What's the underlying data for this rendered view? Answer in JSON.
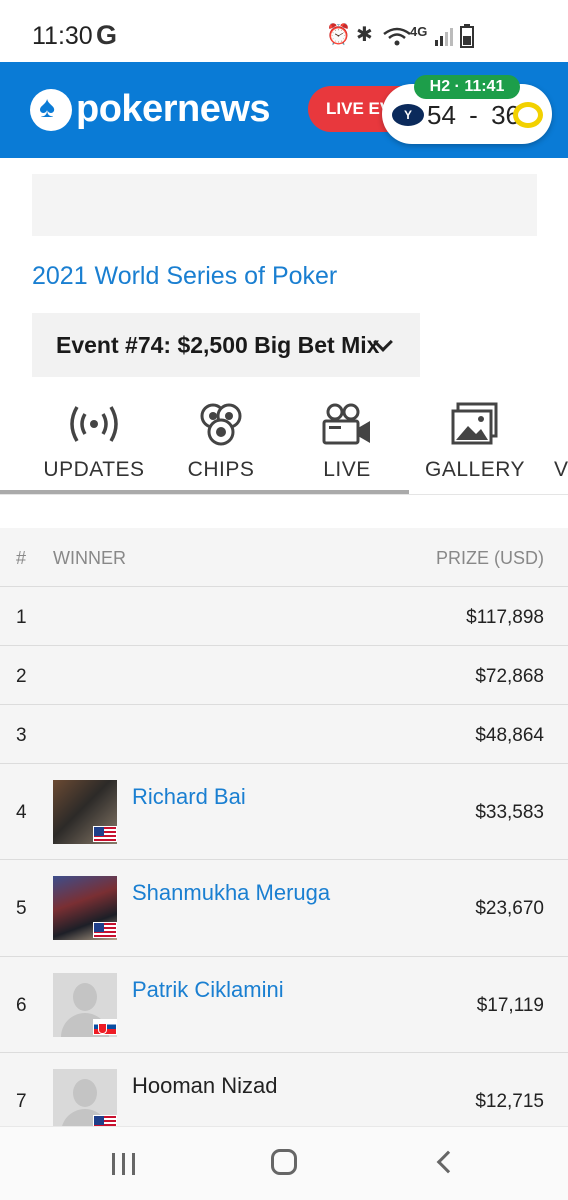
{
  "status_bar": {
    "time": "11:30",
    "g_icon": "G",
    "icons": [
      "alarm-icon",
      "bluetooth-icon",
      "wifi-icon",
      "lte-icon",
      "signal-icon",
      "battery-icon"
    ],
    "network": "4G"
  },
  "header": {
    "logo_text": "pokernews",
    "live_events_label": "LIVE EVE",
    "score": {
      "period": "H2 · 11:41",
      "team1_score": "54",
      "separator": "-",
      "team2_score": "36",
      "team1_icon": "byu-team-logo",
      "team2_icon": "oregon-team-logo"
    }
  },
  "breadcrumb": {
    "series_link": "2021 World Series of Poker"
  },
  "event_select": {
    "selected": "Event #74: $2,500 Big Bet Mix"
  },
  "tabs": [
    {
      "label": "UPDATES",
      "icon": "broadcast-icon"
    },
    {
      "label": "CHIPS",
      "icon": "chips-icon"
    },
    {
      "label": "LIVE",
      "icon": "video-camera-icon"
    },
    {
      "label": "GALLERY",
      "icon": "gallery-icon"
    },
    {
      "label": "V",
      "icon": ""
    }
  ],
  "table": {
    "headers": {
      "rank": "#",
      "winner": "WINNER",
      "prize": "PRIZE (USD)"
    },
    "rows": [
      {
        "rank": "1",
        "name": "",
        "prize": "$117,898"
      },
      {
        "rank": "2",
        "name": "",
        "prize": "$72,868"
      },
      {
        "rank": "3",
        "name": "",
        "prize": "$48,864"
      },
      {
        "rank": "4",
        "name": "Richard Bai",
        "prize": "$33,583",
        "country": "us"
      },
      {
        "rank": "5",
        "name": "Shanmukha Meruga",
        "prize": "$23,670",
        "country": "us"
      },
      {
        "rank": "6",
        "name": "Patrik Ciklamini",
        "prize": "$17,119",
        "country": "sk"
      },
      {
        "rank": "7",
        "name": "Hooman Nizad",
        "prize": "$12,715",
        "country": "us"
      }
    ]
  },
  "nav_bar": {
    "buttons": [
      "recents-icon",
      "home-icon",
      "back-icon"
    ]
  },
  "colors": {
    "brand_blue": "#0a7bd6",
    "live_red": "#e8383d",
    "score_green": "#1d9e4a",
    "link_blue": "#1a7fd1"
  }
}
